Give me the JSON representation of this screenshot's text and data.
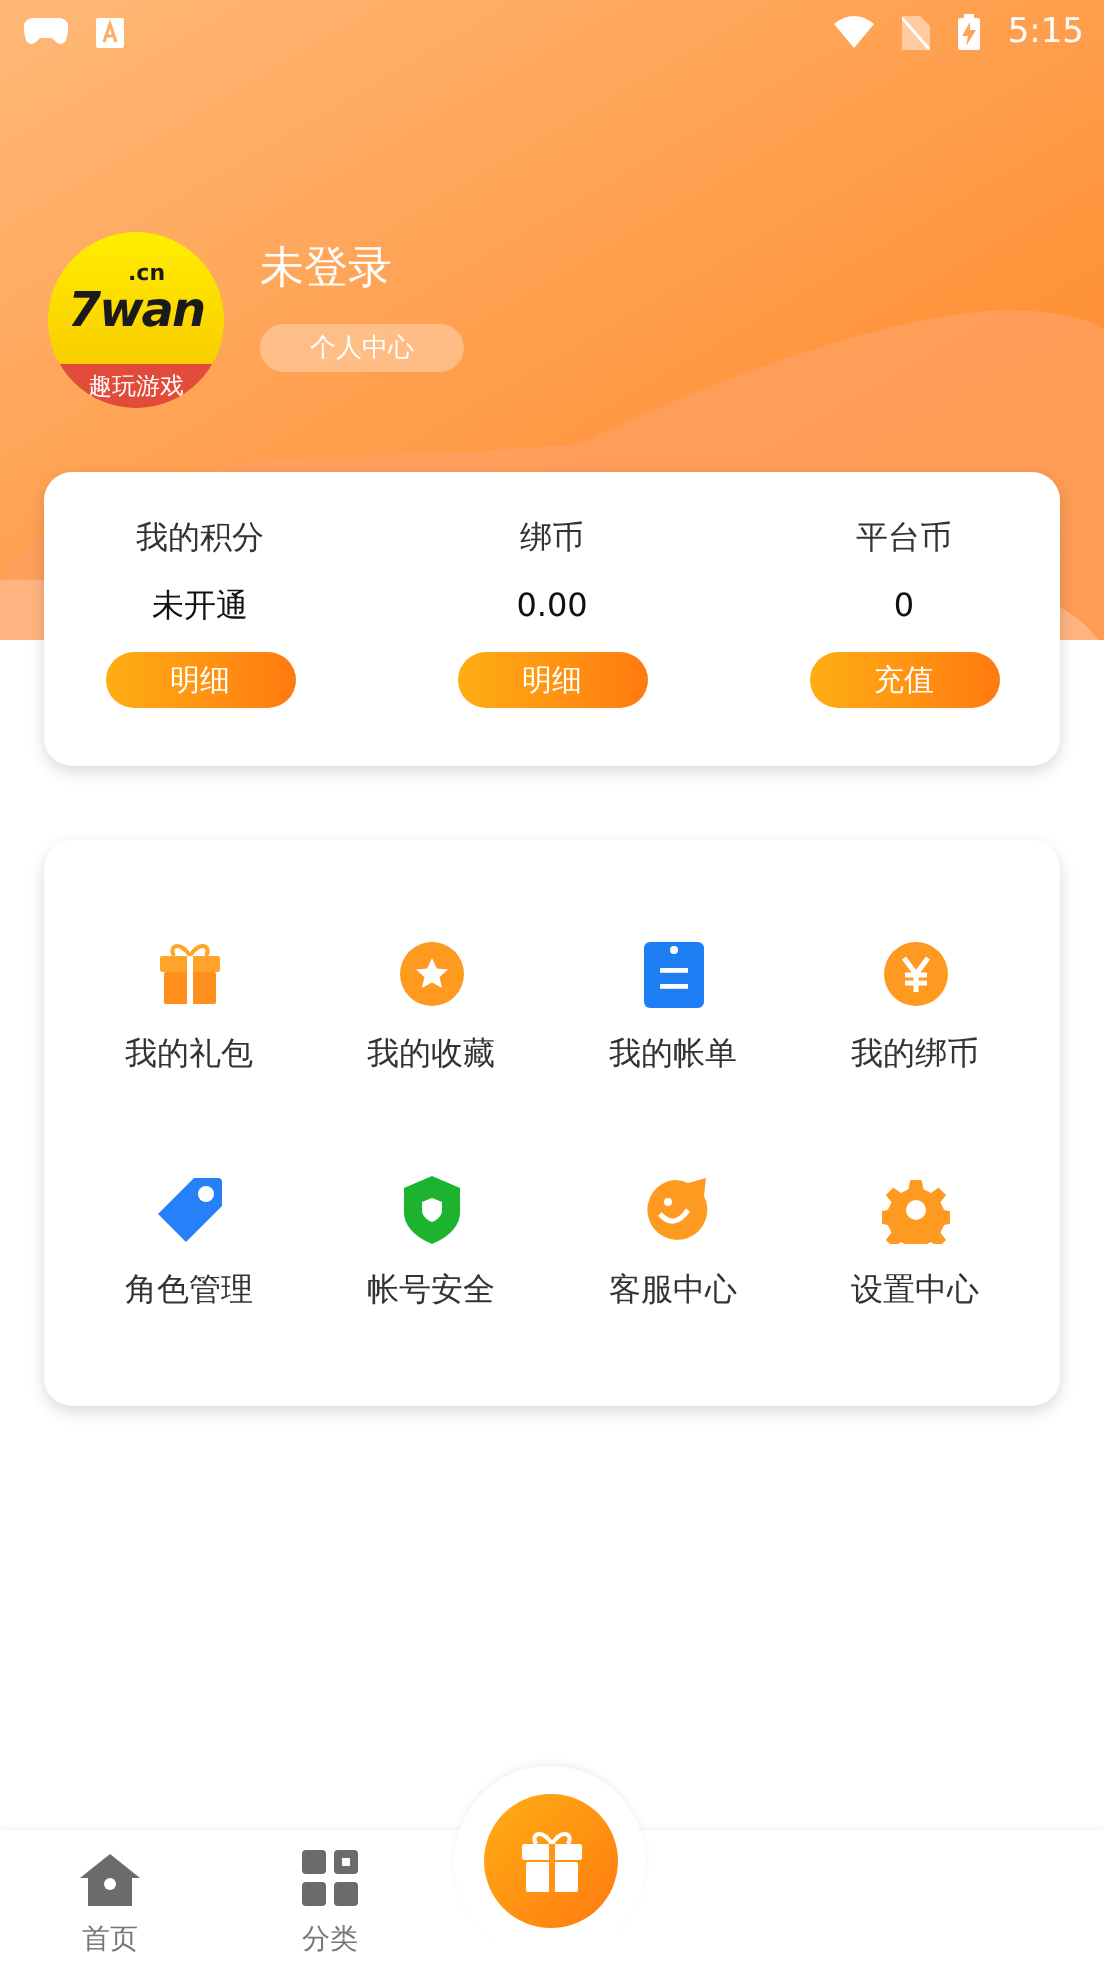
{
  "status_bar": {
    "time": "5:15"
  },
  "profile": {
    "logo": {
      "brand": "7wan",
      "domain": ".cn",
      "slogan": "趣玩游戏"
    },
    "name": "未登录",
    "center_button": "个人中心"
  },
  "wallet": [
    {
      "label": "我的积分",
      "value": "未开通",
      "button": "明细"
    },
    {
      "label": "绑币",
      "value": "0.00",
      "button": "明细"
    },
    {
      "label": "平台币",
      "value": "0",
      "button": "充值"
    }
  ],
  "menu": [
    {
      "label": "我的礼包"
    },
    {
      "label": "我的收藏"
    },
    {
      "label": "我的帐单"
    },
    {
      "label": "我的绑币"
    },
    {
      "label": "角色管理"
    },
    {
      "label": "帐号安全"
    },
    {
      "label": "客服中心"
    },
    {
      "label": "设置中心"
    }
  ],
  "bottom_nav": [
    {
      "label": "首页",
      "selected": false
    },
    {
      "label": "分类",
      "selected": false
    }
  ]
}
